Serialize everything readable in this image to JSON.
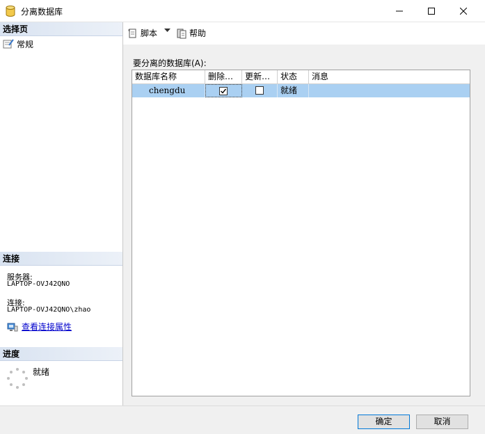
{
  "window": {
    "title": "分离数据库",
    "controls": [
      "minimize-icon",
      "maximize-icon",
      "close-icon"
    ]
  },
  "left_panel": {
    "select_page_header": "选择页",
    "pages": [
      {
        "label": "常规",
        "icon": "general-page-icon"
      }
    ],
    "connection_header": "连接",
    "server_label": "服务器:",
    "server_value": "LAPTOP-OVJ42QNO",
    "connection_label": "连接:",
    "connection_value": "LAPTOP-OVJ42QNO\\zhao",
    "view_properties_link": "查看连接属性",
    "progress_header": "进度",
    "progress_status": "就绪"
  },
  "toolbar": {
    "script_label": "脚本",
    "help_label": "帮助"
  },
  "main": {
    "grid_label": "要分离的数据库(A):",
    "columns": [
      "数据库名称",
      "删除…",
      "更新…",
      "状态",
      "消息"
    ],
    "rows": [
      {
        "name": "chengdu",
        "drop_connections": true,
        "update_statistics": false,
        "status": "就绪",
        "message": ""
      }
    ]
  },
  "footer": {
    "ok_label": "确定",
    "cancel_label": "取消"
  },
  "colors": {
    "selected_row": "#aad0f2",
    "section_header": "#d9e3f1",
    "link": "#0000cc"
  }
}
